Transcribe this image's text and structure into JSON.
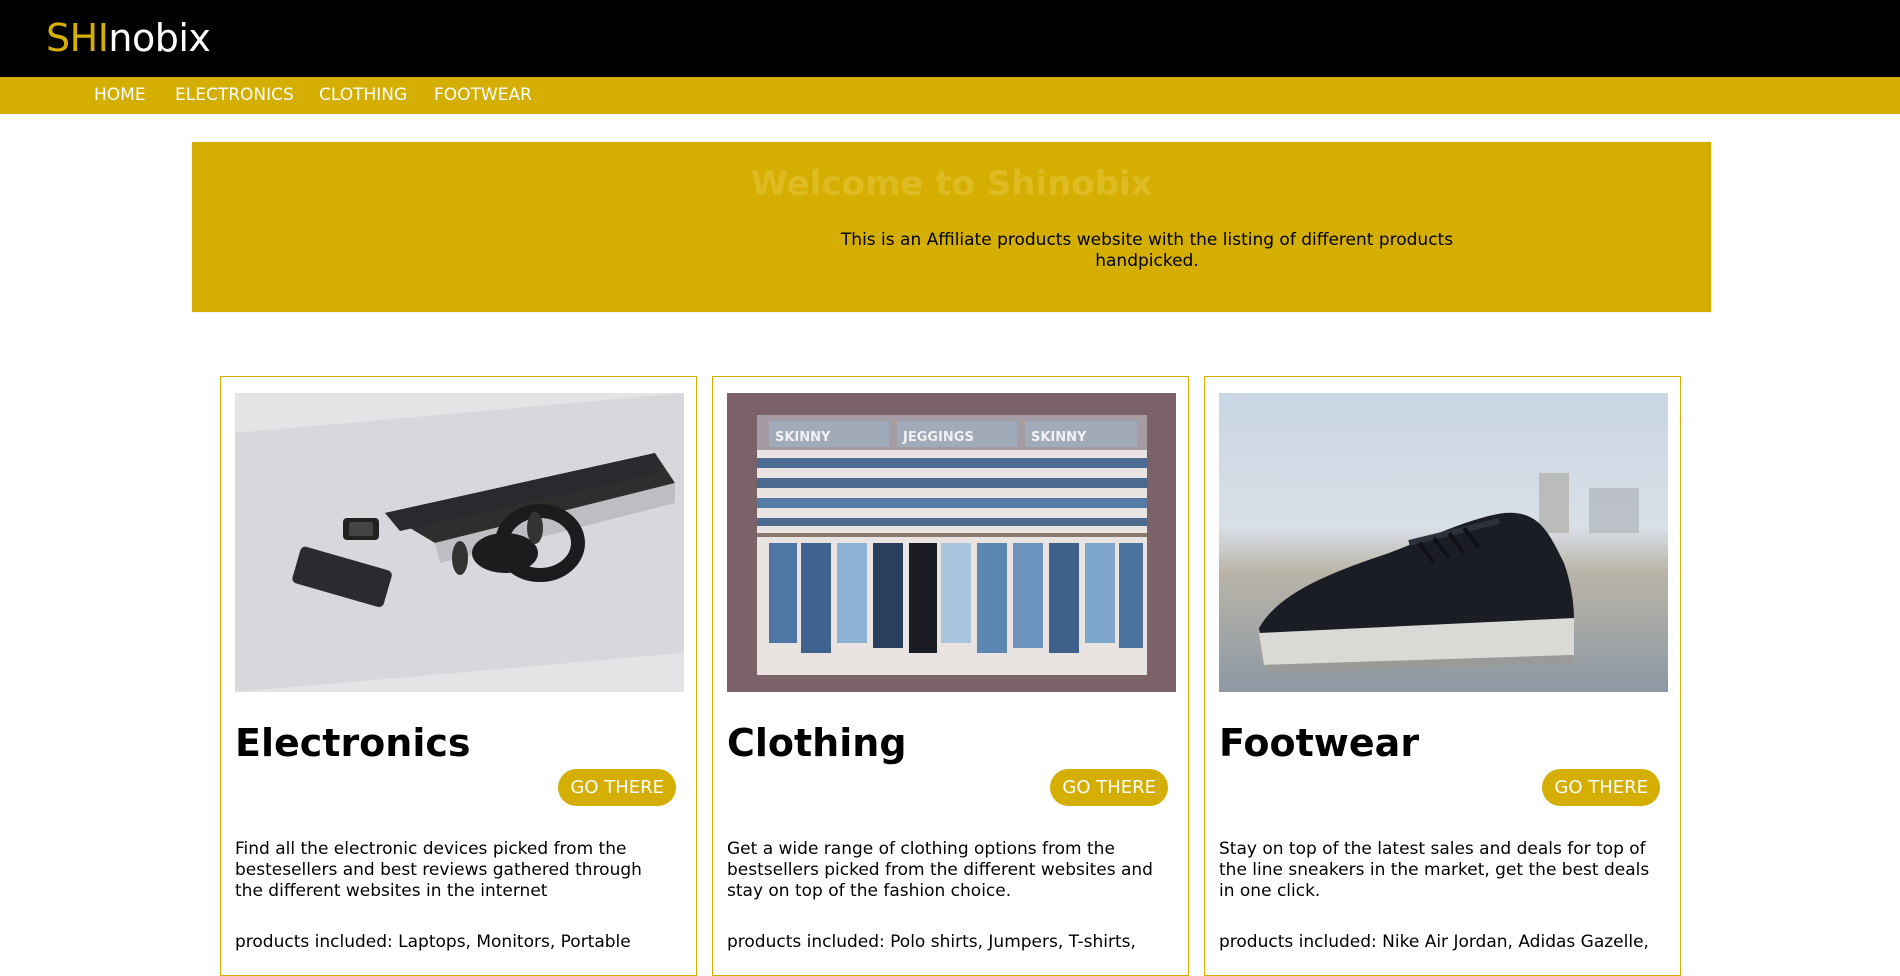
{
  "header": {
    "logo_highlight": "SHI",
    "logo_rest": "nobix"
  },
  "nav": {
    "items": [
      {
        "label": "HOME"
      },
      {
        "label": "ELECTRONICS"
      },
      {
        "label": "CLOTHING"
      },
      {
        "label": "FOOTWEAR"
      }
    ]
  },
  "hero": {
    "title": "Welcome to Shinobix",
    "text": "This is an Affiliate products website with the listing of different products handpicked."
  },
  "cards": [
    {
      "title": "Electronics",
      "button": "GO THERE",
      "description": "Find all the electronic devices picked from the bestesellers and best reviews gathered through the different websites in the internet",
      "included": "products included: Laptops, Monitors, Portable"
    },
    {
      "title": "Clothing",
      "button": "GO THERE",
      "description": "Get a wide range of clothing options from the bestsellers picked from the different websites and stay on top of the fashion choice.",
      "included": "products included: Polo shirts, Jumpers, T-shirts,",
      "image_labels": [
        "SKINNY",
        "JEGGINGS",
        "SKINNY"
      ]
    },
    {
      "title": "Footwear",
      "button": "GO THERE",
      "description": "Stay on top of the latest sales and deals for top of the line sneakers in the market, get the best deals in one click.",
      "included": "products included: Nike Air Jordan, Adidas Gazelle,"
    }
  ],
  "colors": {
    "accent": "#d4ae00",
    "topbar": "#000000"
  }
}
